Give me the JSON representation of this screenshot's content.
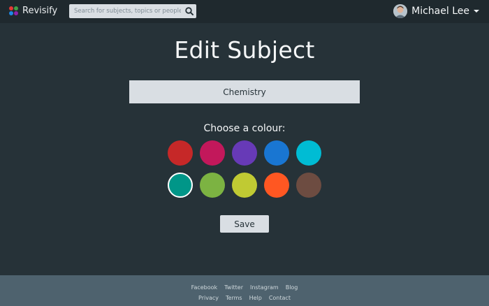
{
  "header": {
    "app_name": "Revisify",
    "search_placeholder": "Search for subjects, topics or people",
    "search_value": "",
    "user_name": "Michael Lee"
  },
  "main": {
    "title": "Edit Subject",
    "subject_name": "Chemistry",
    "colour_label": "Choose a colour:",
    "colours": [
      {
        "hex": "#c62828",
        "selected": false
      },
      {
        "hex": "#c2185b",
        "selected": false
      },
      {
        "hex": "#673ab7",
        "selected": false
      },
      {
        "hex": "#1976d2",
        "selected": false
      },
      {
        "hex": "#00bcd4",
        "selected": false
      },
      {
        "hex": "#009688",
        "selected": true
      },
      {
        "hex": "#7cb342",
        "selected": false
      },
      {
        "hex": "#c0ca33",
        "selected": false
      },
      {
        "hex": "#ff5722",
        "selected": false
      },
      {
        "hex": "#6d4c41",
        "selected": false
      }
    ],
    "save_label": "Save"
  },
  "footer": {
    "row1": [
      "Facebook",
      "Twitter",
      "Instagram",
      "Blog"
    ],
    "row2": [
      "Privacy",
      "Terms",
      "Help",
      "Contact"
    ]
  }
}
